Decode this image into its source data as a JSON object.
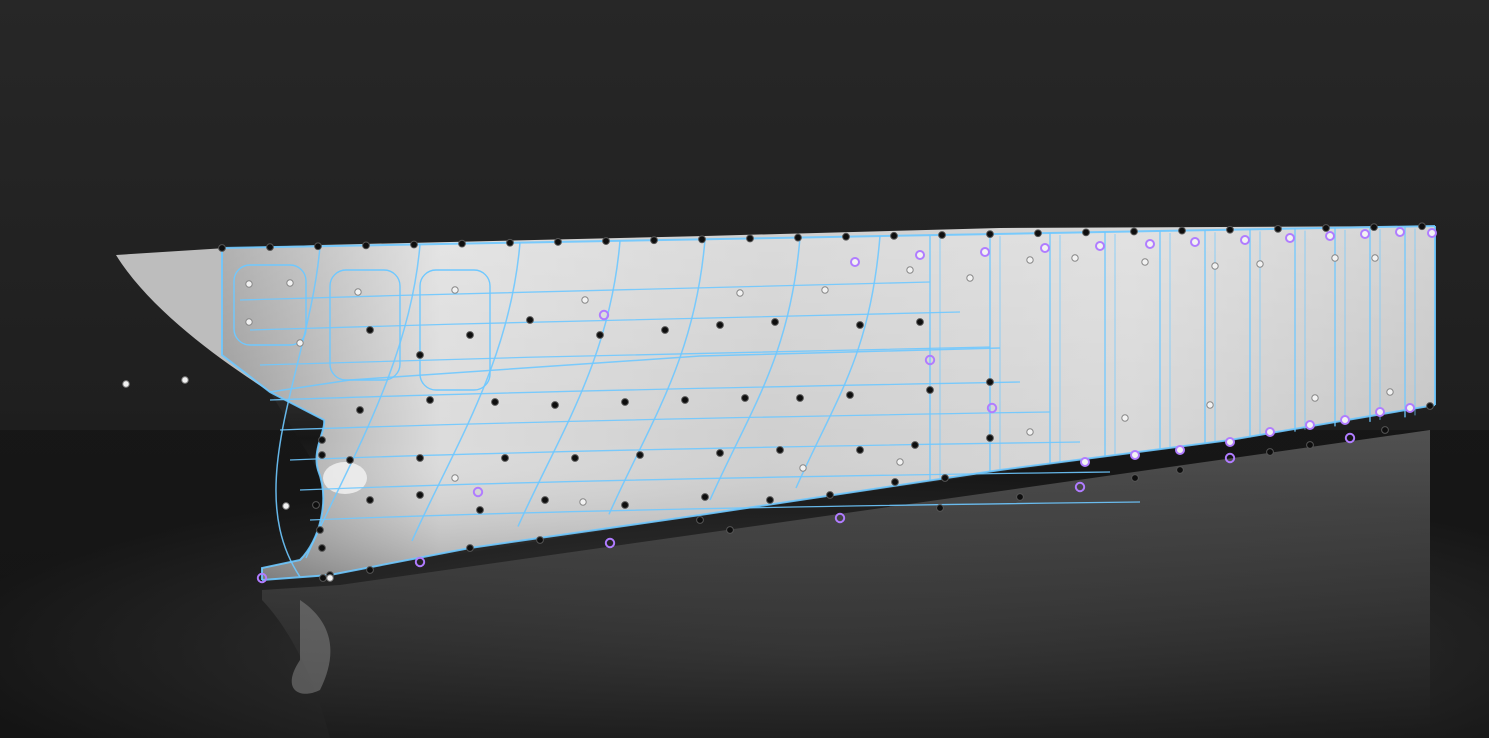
{
  "viewport": {
    "background_top": "#262626",
    "background_bottom": "#0d0d0d",
    "floor_color": "#3a3a3a"
  },
  "hull": {
    "surface_light": "#e3e3e3",
    "surface_mid": "#bdbdbd",
    "surface_dark": "#8c8c8c",
    "reflection": "#5e5e5e"
  },
  "mesh": {
    "edge_color": "#6ec8ff",
    "selected_color": "#b07cff",
    "vertex_dark": "#0e0e0e",
    "vertex_light": "#f2f2f2"
  }
}
